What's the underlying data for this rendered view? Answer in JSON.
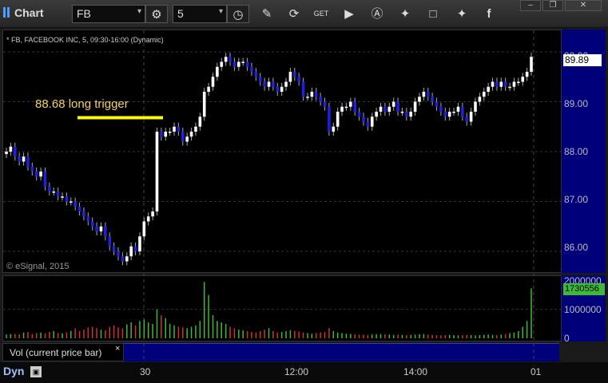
{
  "toolbar": {
    "title": "Chart",
    "symbol": "FB",
    "interval": "5",
    "icons": [
      "symbol-dropdown-icon",
      "settings-gear-icon",
      "interval-dropdown-icon",
      "clock-icon",
      "pencil-draw-icon",
      "refresh-icon",
      "get-quote-icon",
      "play-icon",
      "alert-icon",
      "link-icon",
      "chat-icon",
      "twitter-icon",
      "facebook-icon"
    ],
    "window_controls": [
      "minimize",
      "restore",
      "close"
    ]
  },
  "chart": {
    "series_title": "* FB, FACEBOOK INC, 5, 09:30-16:00 (Dynamic)",
    "copyright": "© eSignal, 2015",
    "annotation": "88.68 long trigger",
    "last_price": "89.89",
    "y_ticks": [
      "90.00",
      "89.00",
      "88.00",
      "87.00",
      "86.00"
    ],
    "vol_ticks": [
      "2000000",
      "1000000",
      "0"
    ],
    "last_volume": "1730556",
    "vol_label": "Vol (current price bar)",
    "vol_close": "×",
    "time_labels": [
      "30",
      "12:00",
      "14:00",
      "01"
    ],
    "mode": "Dyn",
    "colors": {
      "up": "#ffffff",
      "down": "#1f1fdc",
      "vol_up": "#3cba36",
      "vol_down": "#d23030",
      "trigger": "#ffff00"
    }
  },
  "chart_data": {
    "type": "candlestick",
    "price_ylim": [
      85.6,
      90.4
    ],
    "volume_ylim": [
      0,
      2100000
    ],
    "trigger_level": 88.68,
    "close": [
      88.0,
      88.1,
      87.9,
      87.8,
      87.9,
      87.7,
      87.6,
      87.5,
      87.6,
      87.3,
      87.2,
      87.2,
      87.1,
      87.1,
      87.0,
      87.0,
      86.9,
      86.8,
      86.7,
      86.6,
      86.5,
      86.4,
      86.5,
      86.3,
      86.1,
      86.0,
      85.9,
      85.8,
      85.9,
      86.1,
      86.0,
      86.3,
      86.6,
      86.7,
      86.8,
      88.4,
      88.3,
      88.4,
      88.4,
      88.5,
      88.4,
      88.2,
      88.3,
      88.4,
      88.5,
      88.7,
      89.2,
      89.3,
      89.5,
      89.7,
      89.8,
      89.9,
      89.8,
      89.7,
      89.8,
      89.8,
      89.7,
      89.6,
      89.5,
      89.4,
      89.3,
      89.4,
      89.3,
      89.2,
      89.3,
      89.4,
      89.6,
      89.5,
      89.4,
      89.1,
      89.1,
      89.2,
      89.1,
      89.0,
      88.9,
      88.4,
      88.5,
      88.8,
      88.9,
      88.9,
      89.0,
      88.8,
      88.7,
      88.6,
      88.5,
      88.7,
      88.8,
      88.9,
      88.8,
      88.9,
      89.0,
      88.8,
      88.8,
      88.7,
      88.8,
      89.0,
      89.1,
      89.2,
      89.1,
      89.0,
      88.9,
      88.8,
      88.7,
      88.8,
      88.8,
      88.9,
      88.7,
      88.6,
      88.8,
      89.0,
      89.1,
      89.2,
      89.3,
      89.4,
      89.3,
      89.4,
      89.3,
      89.3,
      89.4,
      89.4,
      89.5,
      89.6,
      89.9
    ],
    "volume": [
      130000,
      150000,
      150000,
      140000,
      200000,
      220000,
      150000,
      180000,
      200000,
      170000,
      220000,
      250000,
      180000,
      170000,
      200000,
      260000,
      350000,
      250000,
      300000,
      380000,
      400000,
      350000,
      300000,
      280000,
      400000,
      450000,
      380000,
      350000,
      480000,
      550000,
      450000,
      600000,
      650000,
      550000,
      500000,
      1000000,
      800000,
      700000,
      500000,
      450000,
      400000,
      380000,
      350000,
      400000,
      450000,
      600000,
      1950000,
      1500000,
      800000,
      600000,
      550000,
      500000,
      400000,
      350000,
      300000,
      280000,
      250000,
      220000,
      200000,
      250000,
      300000,
      350000,
      250000,
      200000,
      220000,
      250000,
      280000,
      260000,
      240000,
      200000,
      180000,
      160000,
      180000,
      200000,
      220000,
      350000,
      250000,
      200000,
      180000,
      160000,
      150000,
      140000,
      130000,
      130000,
      120000,
      130000,
      140000,
      150000,
      140000,
      130000,
      120000,
      130000,
      120000,
      110000,
      120000,
      130000,
      140000,
      150000,
      130000,
      120000,
      110000,
      100000,
      110000,
      120000,
      110000,
      100000,
      110000,
      120000,
      110000,
      100000,
      110000,
      120000,
      130000,
      120000,
      110000,
      130000,
      150000,
      180000,
      200000,
      250000,
      400000,
      600000,
      1730556
    ]
  }
}
